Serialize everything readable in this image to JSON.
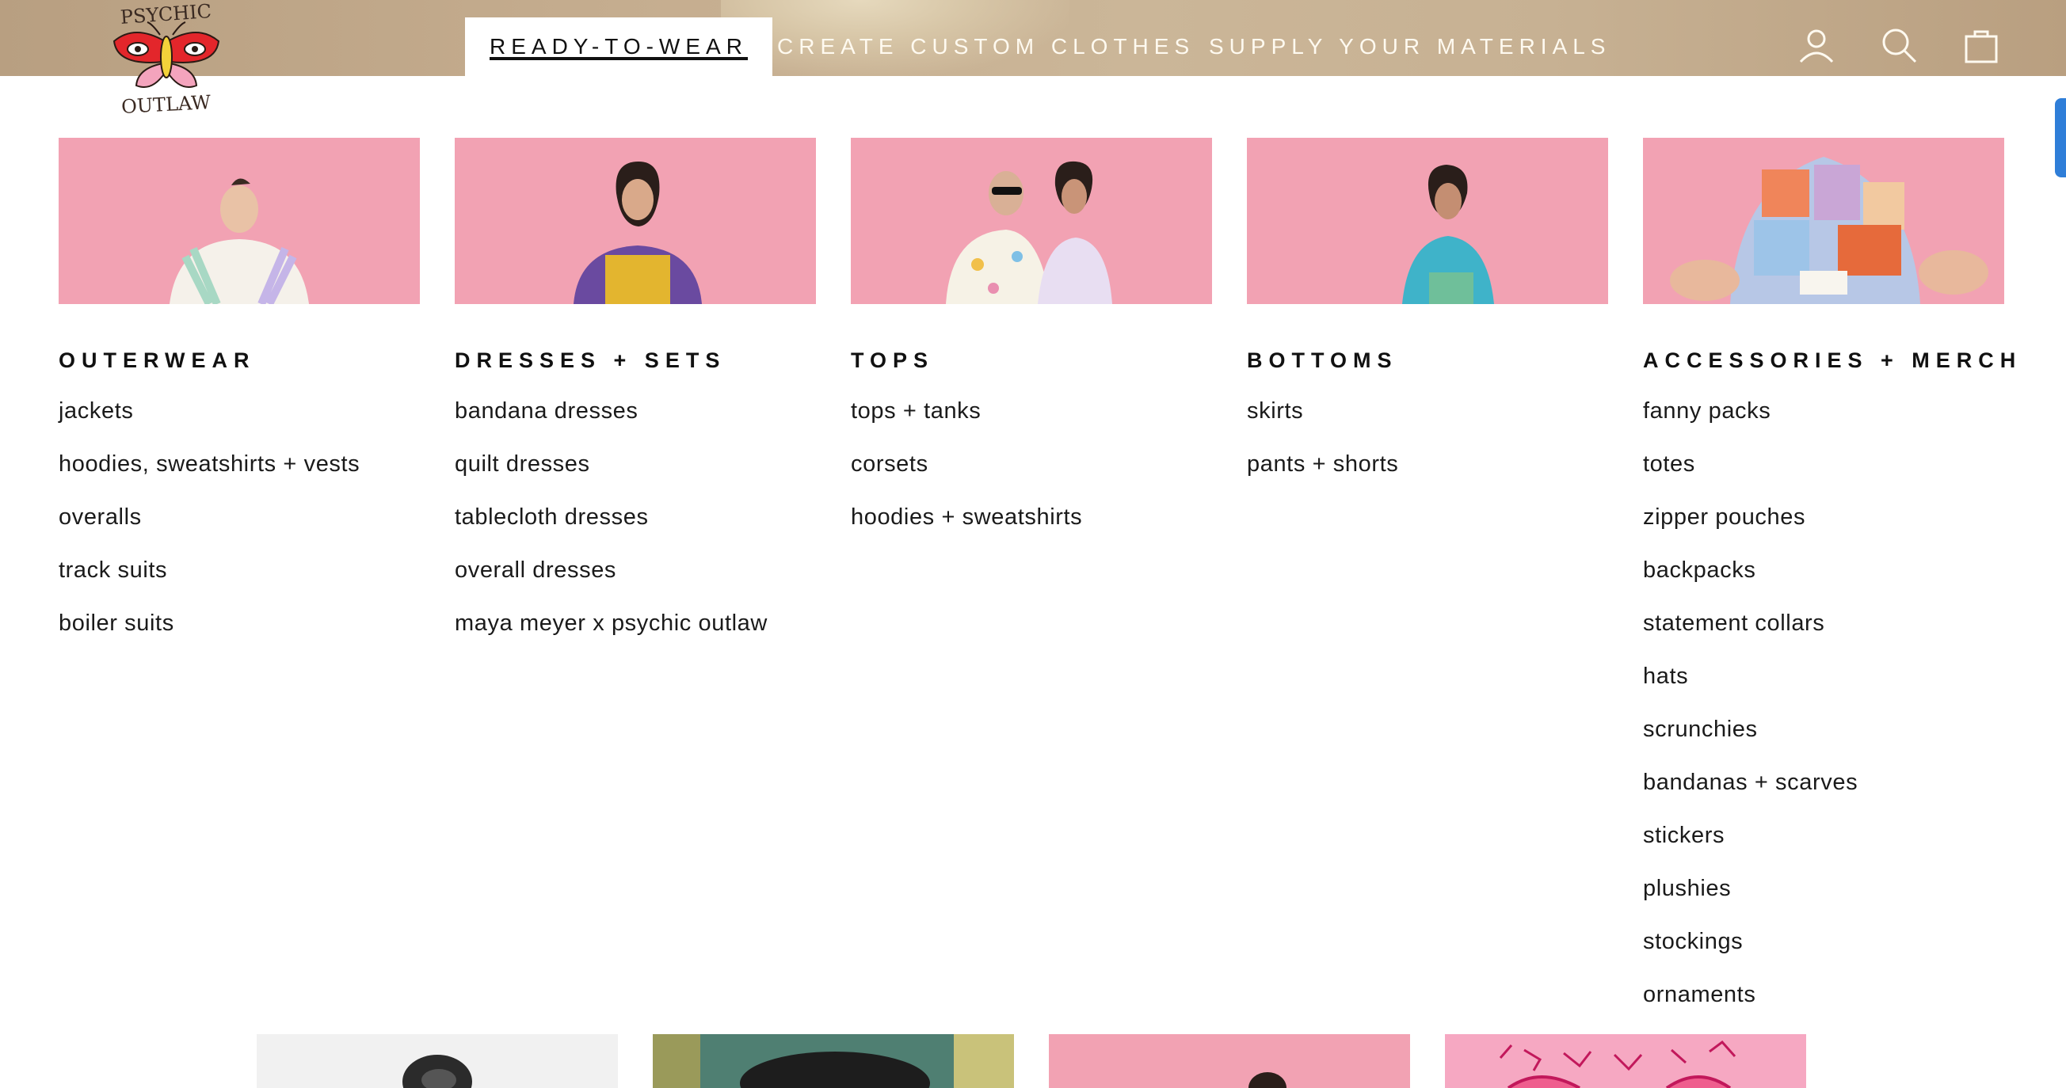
{
  "logo": {
    "text_top": "PSYCHIC",
    "text_bottom": "OUTLAW"
  },
  "nav": {
    "items": [
      {
        "label": "READY-TO-WEAR"
      },
      {
        "label": "CREATE CUSTOM CLOTHES"
      },
      {
        "label": "SUPPLY YOUR MATERIALS"
      }
    ]
  },
  "icons": [
    "account-icon",
    "search-icon",
    "cart-icon"
  ],
  "colors": {
    "accent_active": "#111111",
    "photo_bg": "#f2a2b3",
    "header_bg": "#c5ad8f"
  },
  "menu": {
    "columns": [
      {
        "title": "OUTERWEAR",
        "links": [
          "jackets",
          "hoodies, sweatshirts + vests",
          "overalls",
          "track suits",
          "boiler suits"
        ]
      },
      {
        "title": "DRESSES + SETS",
        "links": [
          "bandana dresses",
          "quilt dresses",
          "tablecloth dresses",
          "overall dresses",
          "maya meyer x psychic outlaw"
        ]
      },
      {
        "title": "TOPS",
        "links": [
          "tops + tanks",
          "corsets",
          "hoodies + sweatshirts"
        ]
      },
      {
        "title": "BOTTOMS",
        "links": [
          "skirts",
          "pants + shorts"
        ]
      },
      {
        "title": "ACCESSORIES + MERCH",
        "links": [
          "fanny packs",
          "totes",
          "zipper pouches",
          "backpacks",
          "statement collars",
          "hats",
          "scrunchies",
          "bandanas + scarves",
          "stickers",
          "plushies",
          "stockings",
          "ornaments"
        ]
      }
    ]
  }
}
